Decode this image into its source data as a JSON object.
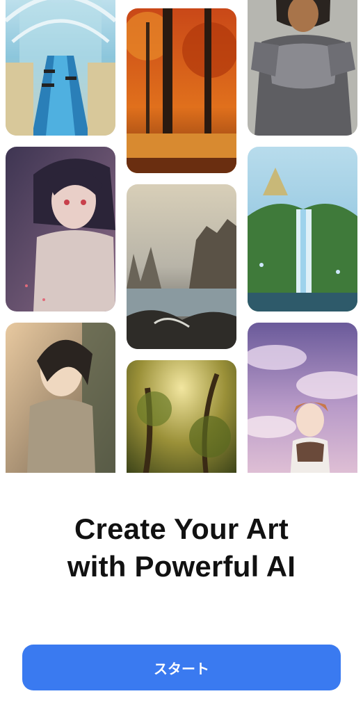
{
  "headline": {
    "line1": "Create Your Art",
    "line2": "with Powerful AI"
  },
  "start_button": {
    "label": "スタート"
  },
  "gallery": {
    "images": [
      {
        "id": "scifi-corridor",
        "accent": "#5fb4d8"
      },
      {
        "id": "anime-girl-pink-eyes",
        "accent": "#7a5a78"
      },
      {
        "id": "anime-girl-short-hair",
        "accent": "#b89a78"
      },
      {
        "id": "autumn-forest",
        "accent": "#d8561c"
      },
      {
        "id": "rocky-coast-painting",
        "accent": "#6a6258"
      },
      {
        "id": "sunlit-forest",
        "accent": "#a8a048"
      },
      {
        "id": "armored-warrior",
        "accent": "#7e7e82"
      },
      {
        "id": "pyramid-waterfall",
        "accent": "#3f8a4a"
      },
      {
        "id": "anime-girl-clouds",
        "accent": "#9a7ab8"
      }
    ]
  },
  "colors": {
    "primary": "#3a7af0",
    "text": "#111111",
    "background": "#ffffff"
  }
}
